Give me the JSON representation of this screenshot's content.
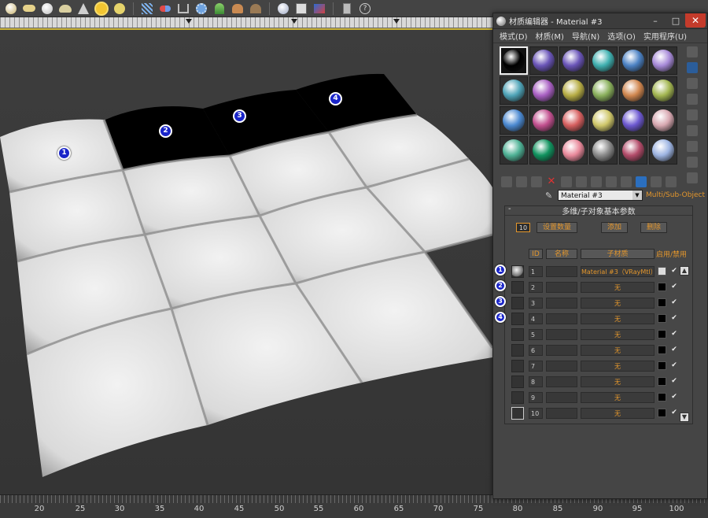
{
  "toolbar": {
    "icons": [
      "torus-icon",
      "capsule-icon",
      "sphere-icon",
      "teapot-icon",
      "cone-icon",
      "sun-light-icon",
      "omni-light-icon",
      "particles-icon",
      "capsule-pill-icon",
      "bone-icon",
      "gear-network-icon",
      "plant-icon",
      "hair-fur-icon",
      "sun-position-icon",
      "material-ball-icon",
      "render-setup-icon",
      "render-frame-icon",
      "box-icon",
      "help-icon"
    ]
  },
  "material_editor": {
    "title": "材质编辑器 - Material #3",
    "menu": [
      "模式(D)",
      "材质(M)",
      "导航(N)",
      "选项(O)",
      "实用程序(U)"
    ],
    "current_material_name": "Material #3",
    "material_type": "Multi/Sub-Object",
    "rollout_title": "多维/子对象基本参数",
    "count_value": "10",
    "set_count_label": "设置数量",
    "add_label": "添加",
    "delete_label": "删除",
    "columns": {
      "id": "ID",
      "name": "名称",
      "sub_material": "子材质",
      "enable": "启用/禁用"
    },
    "sample_slot_colors": [
      "#000000",
      "#6a55b8",
      "#6a55b8",
      "#3fb0b0",
      "#4c82c4",
      "#a78ad8",
      "#4fa4b8",
      "#a85fc2",
      "#b7ad45",
      "#8ab05c",
      "#d1874f",
      "#a3b651",
      "#4b89d1",
      "#c2508f",
      "#d65f5f",
      "#cfc76a",
      "#6d59d1",
      "#d8a8b1",
      "#4fb296",
      "#11935f",
      "#e8889a",
      "#8b8b8b",
      "#b34c6a",
      "#9db4e2"
    ],
    "sub_materials": [
      {
        "id": "1",
        "material": "Material #3（VRayMtl）",
        "color": "white",
        "thumb": "ball"
      },
      {
        "id": "2",
        "material": "无",
        "color": "black",
        "thumb": "empty"
      },
      {
        "id": "3",
        "material": "无",
        "color": "black",
        "thumb": "empty"
      },
      {
        "id": "4",
        "material": "无",
        "color": "black",
        "thumb": "empty"
      },
      {
        "id": "5",
        "material": "无",
        "color": "black",
        "thumb": "empty"
      },
      {
        "id": "6",
        "material": "无",
        "color": "black",
        "thumb": "empty"
      },
      {
        "id": "7",
        "material": "无",
        "color": "black",
        "thumb": "empty"
      },
      {
        "id": "8",
        "material": "无",
        "color": "black",
        "thumb": "empty"
      },
      {
        "id": "9",
        "material": "无",
        "color": "black",
        "thumb": "empty"
      },
      {
        "id": "10",
        "material": "无",
        "color": "black",
        "thumb": "empty"
      }
    ],
    "checkmark": "✔",
    "side_tools": [
      "sample-type-icon",
      "backlight-icon",
      "background-icon",
      "uv-tiling-icon",
      "video-color-check-icon",
      "make-preview-icon",
      "options-icon",
      "select-by-material-icon",
      "material-id-navigator-icon"
    ]
  },
  "viewport": {
    "badges": [
      "1",
      "2",
      "3",
      "4"
    ]
  },
  "timeline": {
    "labels": [
      "20",
      "25",
      "30",
      "35",
      "40",
      "45",
      "50",
      "55",
      "60",
      "65",
      "70",
      "75",
      "80",
      "85",
      "90",
      "95",
      "100"
    ]
  },
  "colors": {
    "accent_orange": "#e3962c",
    "viewport_border": "#c9b237",
    "badge_blue": "#1a25c9",
    "close_red": "#c43b2b"
  }
}
